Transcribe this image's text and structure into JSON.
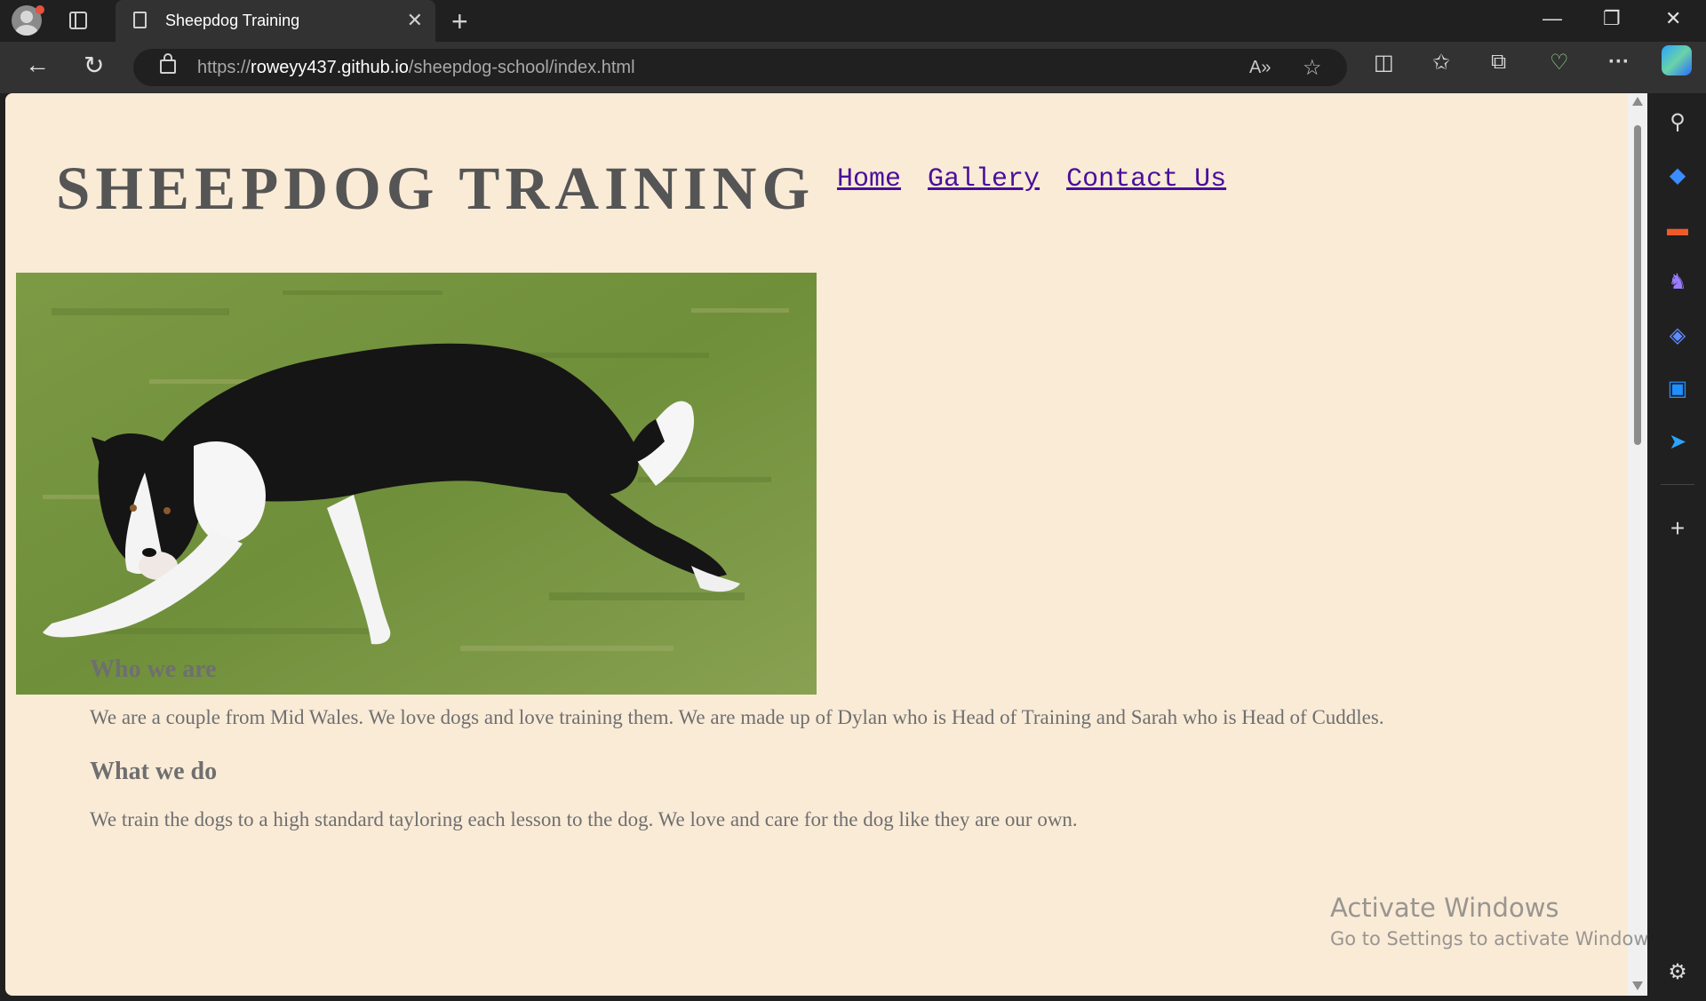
{
  "browser": {
    "tab_title": "Sheepdog Training",
    "tab_close": "✕",
    "new_tab": "+",
    "url_scheme": "https://",
    "url_host": "roweyy437.github.io",
    "url_path": "/sheepdog-school/index.html",
    "window_controls": {
      "minimize": "—",
      "restore": "❐",
      "close": "✕"
    },
    "nav_buttons": {
      "back": "←",
      "refresh": "↻"
    },
    "more_label": "···"
  },
  "sidebar": {
    "icons": [
      "search-icon",
      "shopping-tag-icon",
      "tools-icon",
      "games-icon",
      "copilot-icon",
      "outlook-icon",
      "send-icon",
      "add-icon",
      "settings-icon"
    ]
  },
  "page": {
    "site_title": "SHEEPDOG TRAINING",
    "nav": [
      {
        "label": "Home"
      },
      {
        "label": "Gallery"
      },
      {
        "label": "Contact Us"
      }
    ],
    "sections": [
      {
        "heading": "Who we are",
        "text": "We are a couple from Mid Wales. We love dogs and love training them. We are made up of Dylan who is Head of Training and Sarah who is Head of Cuddles."
      },
      {
        "heading": "What we do",
        "text": "We train the dogs to a high standard tayloring each lesson to the dog. We love and care for the dog like they are our own."
      }
    ]
  },
  "watermark": {
    "line1": "Activate Windows",
    "line2": "Go to Settings to activate Windows."
  },
  "colors": {
    "page_background": "#faebd7",
    "title_text": "#555555",
    "link": "#4b0f9a",
    "body_text": "#6f6f6f",
    "browser_chrome": "#202020"
  }
}
